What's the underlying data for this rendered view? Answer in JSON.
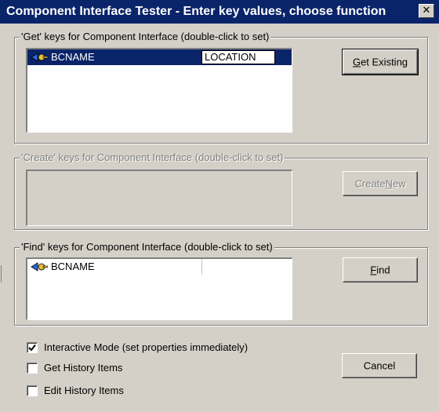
{
  "window": {
    "title": "Component Interface Tester - Enter key values, choose function",
    "close_glyph": "✕"
  },
  "get_group": {
    "label": "'Get' keys for Component Interface (double-click to set)",
    "rows": [
      {
        "icon": "key-icon",
        "name": "BCNAME",
        "value": "LOCATION",
        "selected": true
      }
    ],
    "button": {
      "pre": "",
      "accel": "G",
      "post": "et Existing"
    }
  },
  "create_group": {
    "label": "'Create' keys for Component Interface (double-click to set)",
    "button": {
      "pre": "Create ",
      "accel": "N",
      "post": "ew"
    }
  },
  "find_group": {
    "label": "'Find' keys for Component Interface (double-click to set)",
    "rows": [
      {
        "icon": "key-icon",
        "name": "BCNAME",
        "value": ""
      }
    ],
    "button": {
      "pre": "",
      "accel": "F",
      "post": "ind"
    }
  },
  "options": [
    {
      "label": "Interactive Mode (set properties immediately)",
      "checked": true
    },
    {
      "label": "Get History Items",
      "checked": false
    },
    {
      "label": "Edit History Items",
      "checked": false
    }
  ],
  "cancel_button": {
    "label": "Cancel"
  },
  "colors": {
    "titlebar": "#0a246a",
    "dialog_face": "#d4d0c8",
    "selection": "#0a246a"
  }
}
